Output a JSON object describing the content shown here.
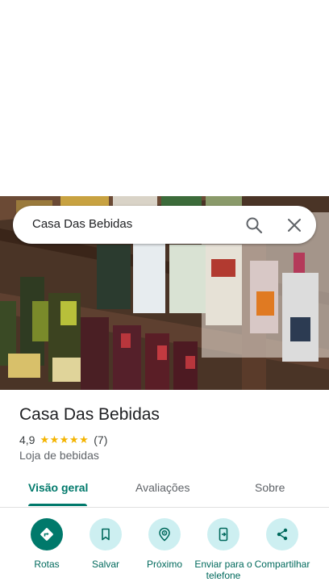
{
  "colors": {
    "accent": "#00796b",
    "action_bg": "#cdeff1",
    "star": "#f4b400"
  },
  "search": {
    "query": "Casa Das Bebidas",
    "search_icon": "search-icon",
    "close_icon": "close-icon"
  },
  "place": {
    "title": "Casa Das Bebidas",
    "rating": "4,9",
    "stars": "★★★★★",
    "stars_value": 4.9,
    "review_count": "(7)",
    "category": "Loja de bebidas"
  },
  "tabs": [
    {
      "label": "Visão geral",
      "active": true
    },
    {
      "label": "Avaliações",
      "active": false
    },
    {
      "label": "Sobre",
      "active": false
    }
  ],
  "actions": [
    {
      "label": "Rotas",
      "icon": "directions-icon"
    },
    {
      "label": "Salvar",
      "icon": "bookmark-icon"
    },
    {
      "label": "Próximo",
      "icon": "nearby-icon"
    },
    {
      "label": "Enviar para o telefone",
      "icon": "send-to-phone-icon"
    },
    {
      "label": "Compartilhar",
      "icon": "share-icon"
    }
  ]
}
